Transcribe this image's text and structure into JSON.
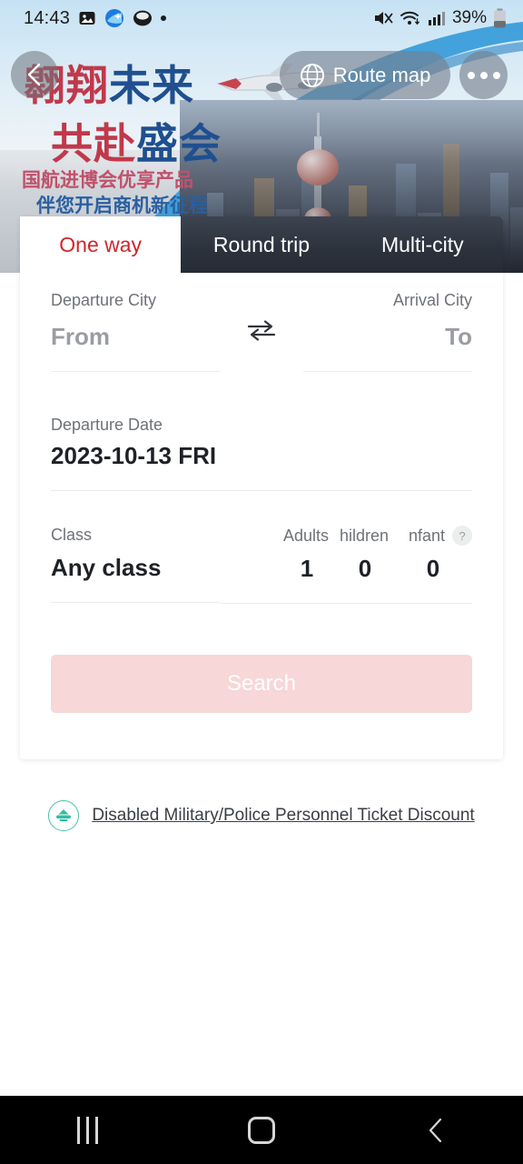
{
  "status_bar": {
    "time": "14:43",
    "battery_percent": "39%",
    "icons": [
      "image-icon",
      "browser-globe-icon",
      "ellipse-app-icon",
      "dot-icon",
      "mute-icon",
      "wifi-icon",
      "signal-icon",
      "battery-icon"
    ]
  },
  "hero": {
    "headline_line1_red": "翱翔",
    "headline_line1_blue": "未来",
    "headline_line2_red": "共赴",
    "headline_line2_blue": "盛会",
    "subtitle_line1": "国航进博会优享产品",
    "subtitle_line2": "伴您开启商机新征程",
    "back_label": "Back",
    "route_map_label": "Route map",
    "more_label": "More options"
  },
  "tabs": [
    {
      "label": "One way",
      "active": true
    },
    {
      "label": "Round trip",
      "active": false
    },
    {
      "label": "Multi-city",
      "active": false
    }
  ],
  "form": {
    "departure_city_label": "Departure City",
    "arrival_city_label": "Arrival City",
    "departure_city_value": "From",
    "arrival_city_value": "To",
    "swap_label": "Swap cities",
    "departure_date_label": "Departure Date",
    "departure_date_value": "2023-10-13 FRI",
    "class_label": "Class",
    "class_value": "Any class",
    "passengers": [
      {
        "label": "Adults",
        "value": "1"
      },
      {
        "label": "hildren",
        "value": "0"
      },
      {
        "label": "nfant",
        "value": "0"
      }
    ],
    "help_label": "?",
    "search_label": "Search"
  },
  "discount": {
    "label": "Disabled Military/Police Personnel Ticket Discount"
  },
  "nav": {
    "recents_label": "Recents",
    "home_label": "Home",
    "back_label": "Back"
  },
  "colors": {
    "accent_red": "#d0252c",
    "search_disabled_bg": "#f7d7d8",
    "headline_red": "#c0394b",
    "headline_blue": "#1f4f8f",
    "discount_teal": "#49c3a6"
  }
}
